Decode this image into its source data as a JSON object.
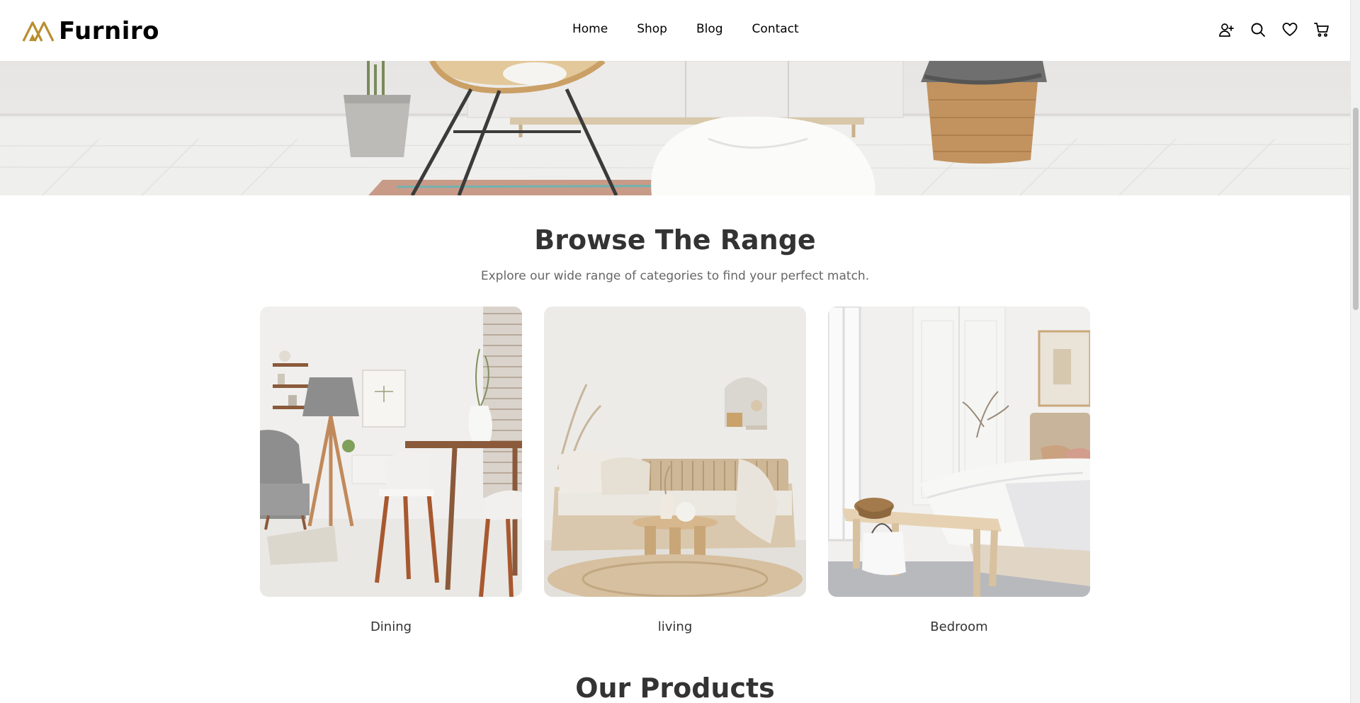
{
  "header": {
    "logo_text": "Furniro",
    "brand_color": "#B88E2F",
    "nav": [
      {
        "label": "Home"
      },
      {
        "label": "Shop"
      },
      {
        "label": "Blog"
      },
      {
        "label": "Contact"
      }
    ],
    "icons": [
      "user-plus-icon",
      "search-icon",
      "heart-icon",
      "cart-icon"
    ]
  },
  "browse": {
    "title": "Browse The Range",
    "subtitle": "Explore our wide range of categories to find your perfect match.",
    "categories": [
      {
        "label": "Dining"
      },
      {
        "label": "living"
      },
      {
        "label": "Bedroom"
      }
    ]
  },
  "products": {
    "title": "Our Products"
  },
  "colors": {
    "heading": "#333333",
    "subtext": "#666666",
    "accent": "#B88E2F"
  }
}
